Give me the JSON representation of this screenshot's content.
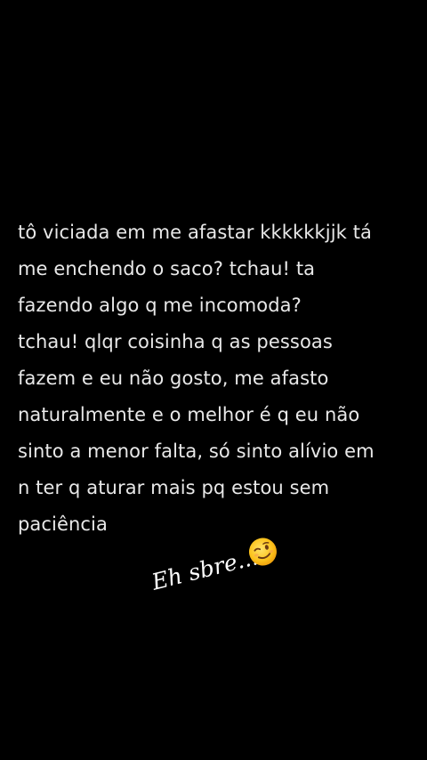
{
  "story": {
    "background_color": "#000000",
    "text_color": "#e8e8e8",
    "lines": [
      "tô viciada em me afastar kkkkkkjjk tá",
      "me enchendo o saco? tchau! ta",
      "fazendo algo q me incomoda?",
      "tchau! qlqr coisinha q as pessoas",
      "fazem e eu não gosto, me afasto",
      "naturalmente e o melhor é q eu não",
      "sinto a menor falta, só sinto alívio em",
      "n ter q aturar mais pq estou sem",
      "paciência"
    ]
  },
  "sticker": {
    "text": "Eh sbre....",
    "emoji": "winking-face-icon"
  }
}
